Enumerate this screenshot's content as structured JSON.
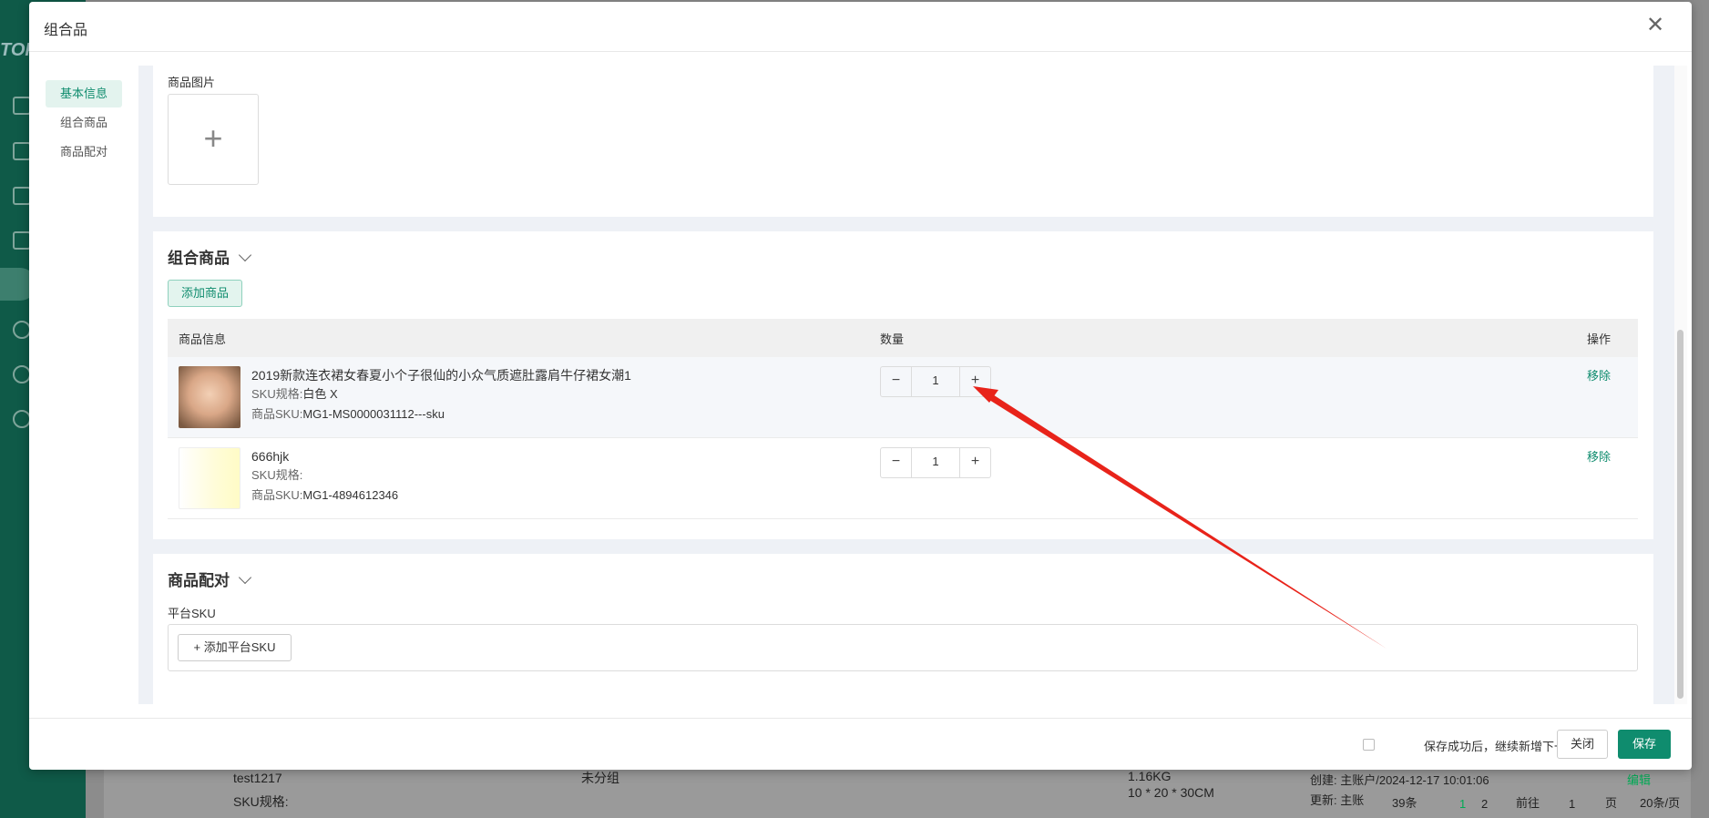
{
  "modal": {
    "title": "组合品",
    "close_icon": "close-icon"
  },
  "side_nav": {
    "items": [
      "基本信息",
      "组合商品",
      "商品配对"
    ],
    "active_index": 0
  },
  "basic": {
    "image_label": "商品图片",
    "upload_symbol": "+"
  },
  "bundle": {
    "title": "组合商品",
    "add_button": "添加商品",
    "columns": {
      "info": "商品信息",
      "quantity": "数量",
      "action": "操作"
    },
    "sku_spec_label": "SKU规格:",
    "sku_label": "商品SKU:",
    "rows": [
      {
        "name": "2019新款连衣裙女春夏小个子很仙的小众气质遮肚露肩牛仔裙女潮1",
        "spec": "白色 X",
        "sku": "MG1-MS0000031112---sku",
        "qty": "1",
        "action": "移除"
      },
      {
        "name": "666hjk",
        "spec": "",
        "sku": "MG1-4894612346",
        "qty": "1",
        "action": "移除"
      }
    ],
    "minus": "−",
    "plus": "+"
  },
  "pairing": {
    "title": "商品配对",
    "platform_label": "平台SKU",
    "add_button": "+ 添加平台SKU"
  },
  "footer": {
    "checkbox_label": "保存成功后，继续新增下一个",
    "close_button": "关闭",
    "save_button": "保存"
  },
  "background": {
    "logo": "TOP",
    "row_name": "test1217",
    "row_spec": "SKU规格:",
    "row_group": "未分组",
    "row_weight": "1.16KG",
    "row_size": "10 * 20 * 30CM",
    "row_created": "创建: 主账户/2024-12-17 10:01:06",
    "row_updated": "更新: 主账",
    "row_edit": "编辑",
    "pager_total": "39条",
    "pager_page1": "1",
    "pager_page2": "2",
    "pager_goto": "前往",
    "pager_goto_value": "1",
    "pager_unit": "页",
    "pager_size": "20条/页"
  },
  "colors": {
    "accent": "#0f8c6e",
    "arrow": "#e8231a"
  }
}
